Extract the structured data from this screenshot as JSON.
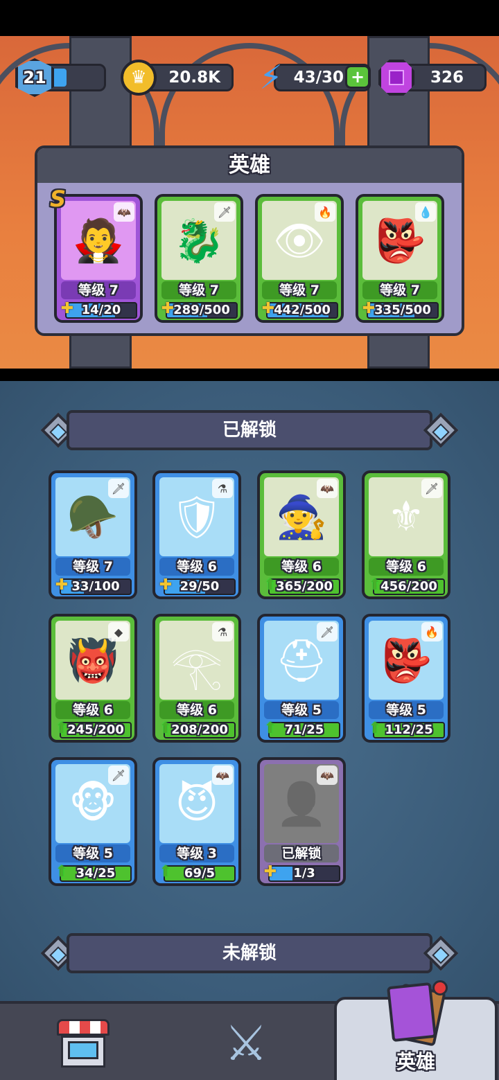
{
  "status_bar": {
    "player_level": "21",
    "player_xp_progress": 0.3,
    "gold": "20.8K",
    "energy": "43/30",
    "gems": "326"
  },
  "hero_panel": {
    "title": "英雄",
    "rank_badge": "S",
    "heroes": [
      {
        "level": "等级 7",
        "progress_text": "14/20",
        "progress": 0.7,
        "color": "purple",
        "element": "bat-icon",
        "portrait": "vampire-icon"
      },
      {
        "level": "等级 7",
        "progress_text": "289/500",
        "progress": 0.58,
        "color": "green",
        "element": "sword-icon",
        "portrait": "dragon-knight-icon"
      },
      {
        "level": "等级 7",
        "progress_text": "442/500",
        "progress": 0.88,
        "color": "green",
        "element": "fire-icon",
        "portrait": "eye-demon-icon"
      },
      {
        "level": "等级 7",
        "progress_text": "335/500",
        "progress": 0.67,
        "color": "green",
        "element": "water-icon",
        "portrait": "goblin-shaman-icon"
      }
    ]
  },
  "unlocked_section": {
    "title": "已解锁",
    "cards": [
      {
        "level": "等级 7",
        "progress_text": "33/100",
        "progress": 0.33,
        "color": "blue",
        "icon_type": "puzzle",
        "element": "sword-icon",
        "portrait": "viking-icon"
      },
      {
        "level": "等级 6",
        "progress_text": "29/50",
        "progress": 0.58,
        "color": "blue",
        "icon_type": "puzzle",
        "element": "potion-icon",
        "portrait": "knight-icon"
      },
      {
        "level": "等级 6",
        "progress_text": "365/200",
        "progress": 1,
        "color": "green",
        "icon_type": "arrow",
        "element": "bat-icon",
        "portrait": "witch-icon"
      },
      {
        "level": "等级 6",
        "progress_text": "456/200",
        "progress": 1,
        "color": "green",
        "icon_type": "arrow",
        "element": "sword-icon",
        "portrait": "paladin-icon"
      },
      {
        "level": "等级 6",
        "progress_text": "245/200",
        "progress": 1,
        "color": "green",
        "icon_type": "arrow",
        "element": "rock-icon",
        "portrait": "orc-icon"
      },
      {
        "level": "等级 6",
        "progress_text": "208/200",
        "progress": 1,
        "color": "green",
        "icon_type": "arrow",
        "element": "potion-icon",
        "portrait": "pharaoh-icon"
      },
      {
        "level": "等级 5",
        "progress_text": "71/25",
        "progress": 1,
        "color": "blue",
        "icon_type": "arrow",
        "element": "sword-icon",
        "portrait": "helmet-warrior-icon"
      },
      {
        "level": "等级 5",
        "progress_text": "112/25",
        "progress": 1,
        "color": "blue",
        "icon_type": "arrow",
        "element": "fire-icon",
        "portrait": "goblin-icon"
      },
      {
        "level": "等级 5",
        "progress_text": "34/25",
        "progress": 1,
        "color": "blue",
        "icon_type": "arrow",
        "element": "sword-icon",
        "portrait": "monkey-icon"
      },
      {
        "level": "等级 3",
        "progress_text": "69/5",
        "progress": 1,
        "color": "blue",
        "icon_type": "arrow",
        "element": "bat-icon",
        "portrait": "succubus-icon"
      },
      {
        "level": "已解锁",
        "progress_text": "1/3",
        "progress": 0.33,
        "color": "gray",
        "icon_type": "puzzle",
        "element": "bat-icon",
        "portrait": "locked-hero-icon"
      }
    ]
  },
  "locked_section": {
    "title": "未解锁"
  },
  "bottom_nav": {
    "tabs": [
      {
        "name": "shop",
        "icon": "shop-icon"
      },
      {
        "name": "battle",
        "icon": "crossed-swords-icon"
      },
      {
        "name": "heroes",
        "icon": "hero-card-icon",
        "label": "英雄"
      }
    ]
  }
}
